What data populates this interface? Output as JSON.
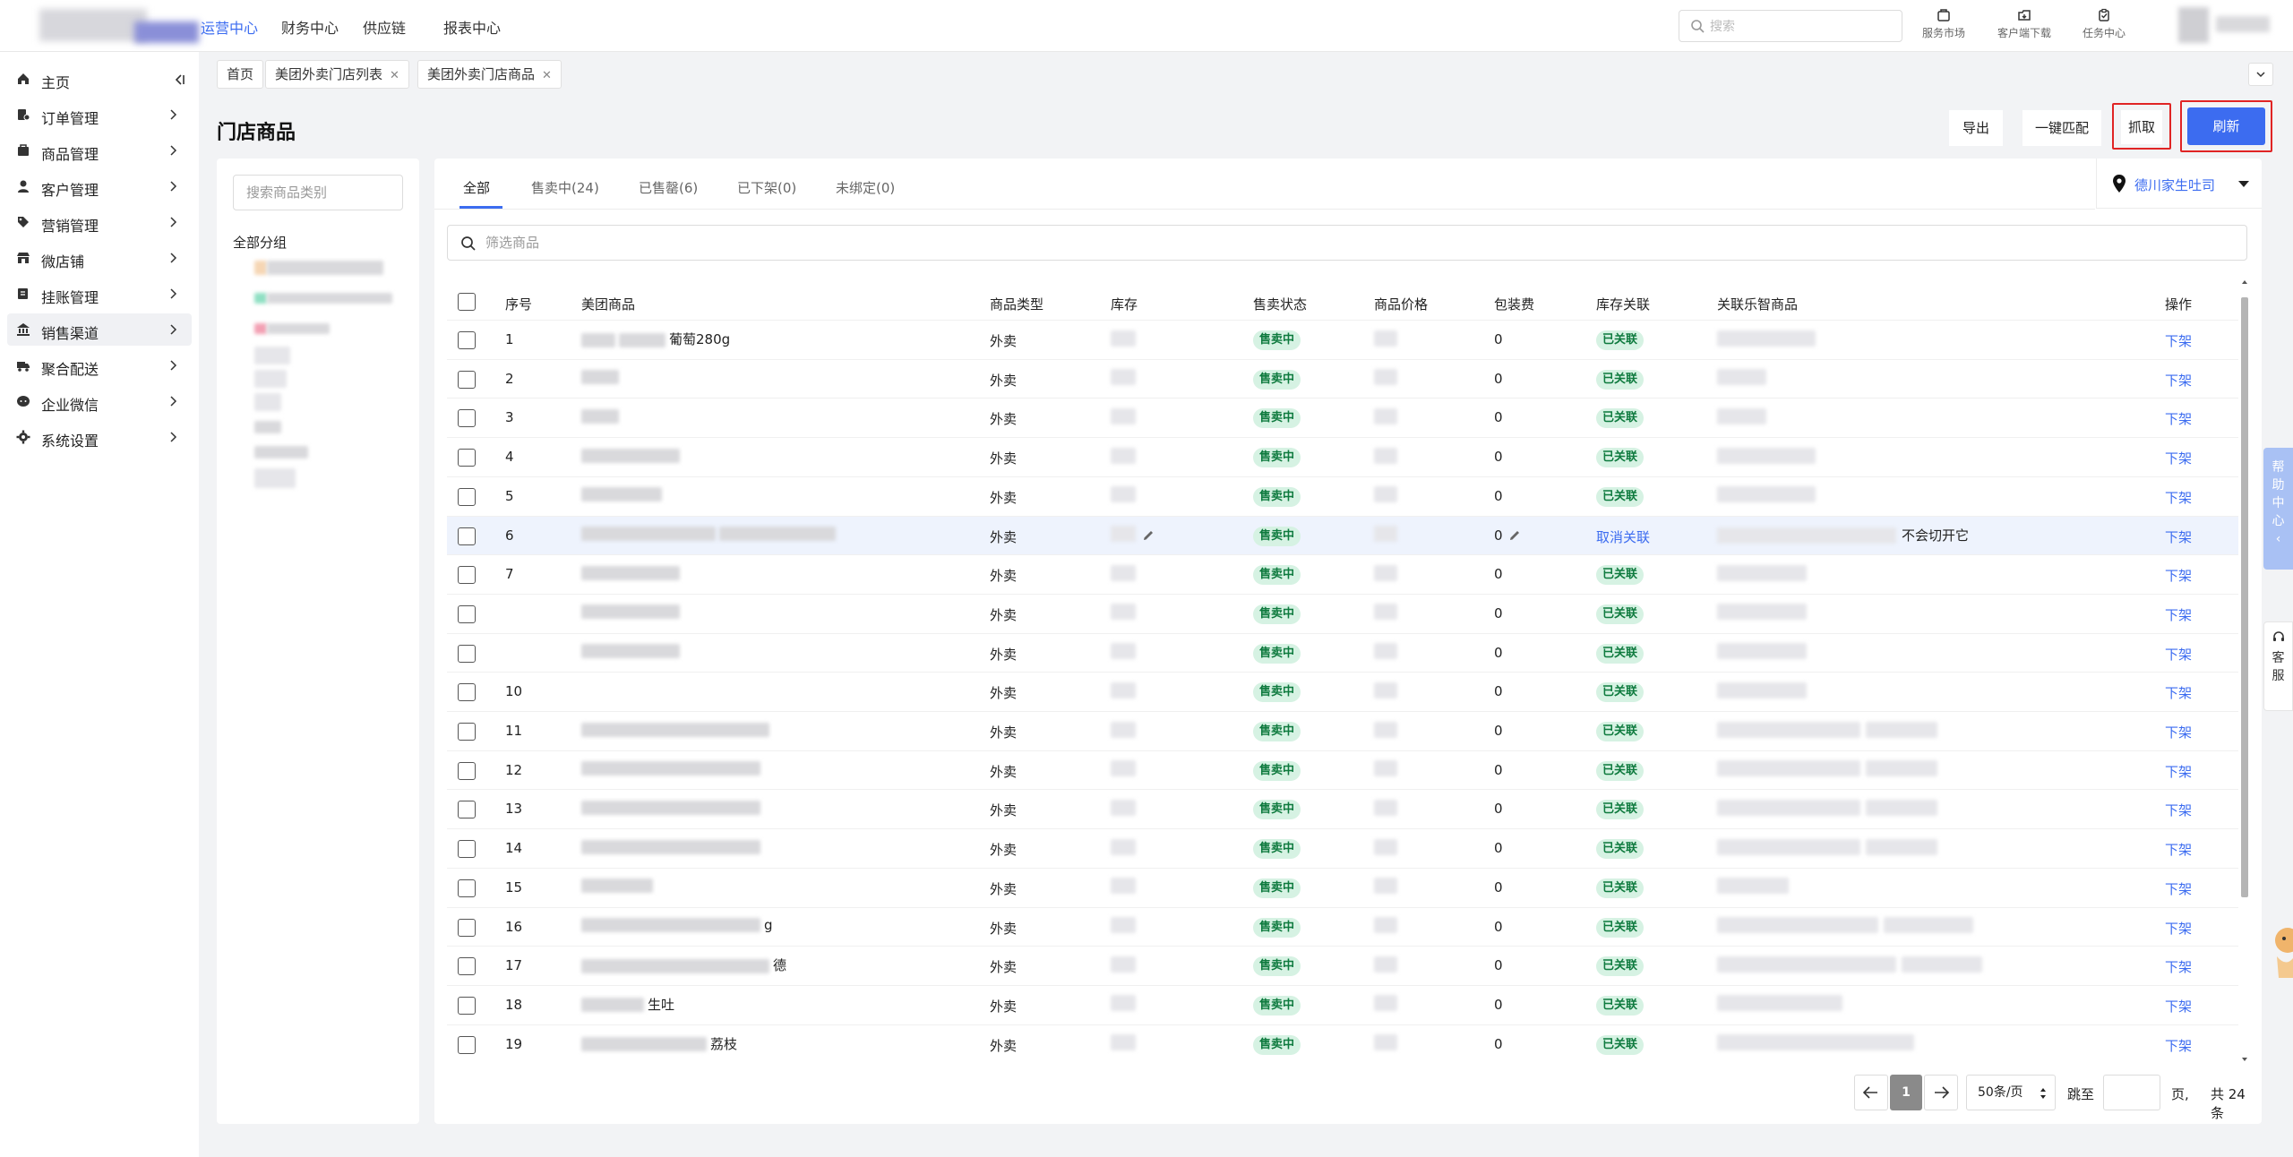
{
  "nav": {
    "menus": [
      "运营中心",
      "财务中心",
      "供应链",
      "报表中心"
    ],
    "search_placeholder": "搜索",
    "icons": [
      {
        "label": "服务市场",
        "icon": "shop-icon"
      },
      {
        "label": "客户端下载",
        "icon": "download-icon"
      },
      {
        "label": "任务中心",
        "icon": "task-icon"
      }
    ]
  },
  "sidebar": {
    "items": [
      {
        "label": "主页",
        "icon": "home-icon"
      },
      {
        "label": "订单管理",
        "icon": "order-icon"
      },
      {
        "label": "商品管理",
        "icon": "goods-icon"
      },
      {
        "label": "客户管理",
        "icon": "customer-icon"
      },
      {
        "label": "营销管理",
        "icon": "tag-icon"
      },
      {
        "label": "微店铺",
        "icon": "store-icon"
      },
      {
        "label": "挂账管理",
        "icon": "ledger-icon"
      },
      {
        "label": "销售渠道",
        "icon": "bank-icon",
        "active": true
      },
      {
        "label": "聚合配送",
        "icon": "truck-icon"
      },
      {
        "label": "企业微信",
        "icon": "wechat-icon"
      },
      {
        "label": "系统设置",
        "icon": "gear-icon"
      }
    ]
  },
  "pagetabs": [
    {
      "label": "首页",
      "closable": false
    },
    {
      "label": "美团外卖门店列表",
      "closable": true
    },
    {
      "label": "美团外卖门店商品",
      "closable": true
    }
  ],
  "header": {
    "title": "门店商品",
    "export": "导出",
    "match": "一键匹配",
    "fetch": "抓取",
    "refresh": "刷新"
  },
  "category": {
    "search_placeholder": "搜索商品类别",
    "all": "全部分组"
  },
  "filter_tabs": [
    {
      "label": "全部",
      "active": true
    },
    {
      "label": "售卖中(24)"
    },
    {
      "label": "已售罄(6)"
    },
    {
      "label": "已下架(0)"
    },
    {
      "label": "未绑定(0)"
    }
  ],
  "store": {
    "name": "德川家生吐司"
  },
  "filter_placeholder": "筛选商品",
  "table": {
    "columns": [
      "序号",
      "美团商品",
      "商品类型",
      "库存",
      "售卖状态",
      "商品价格",
      "包装费",
      "库存关联",
      "关联乐智商品",
      "操作"
    ],
    "rows": [
      {
        "seq": "1",
        "name": "葡萄280g",
        "type": "外卖",
        "status": "售卖中",
        "fee": "0",
        "link": "已关联",
        "op": "下架"
      },
      {
        "seq": "2",
        "name": "",
        "type": "外卖",
        "status": "售卖中",
        "fee": "0",
        "link": "已关联",
        "op": "下架"
      },
      {
        "seq": "3",
        "name": "",
        "type": "外卖",
        "status": "售卖中",
        "fee": "0",
        "link": "已关联",
        "op": "下架"
      },
      {
        "seq": "4",
        "name": "",
        "type": "外卖",
        "status": "售卖中",
        "fee": "0",
        "link": "已关联",
        "op": "下架"
      },
      {
        "seq": "5",
        "name": "",
        "type": "外卖",
        "status": "售卖中",
        "fee": "0",
        "link": "已关联",
        "op": "下架"
      },
      {
        "seq": "6",
        "name": "",
        "type": "外卖",
        "status": "售卖中",
        "fee": "0",
        "link": "取消关联",
        "linked_name": "不会切开它",
        "op": "下架",
        "highlight": true
      },
      {
        "seq": "7",
        "name": "",
        "type": "外卖",
        "status": "售卖中",
        "fee": "0",
        "link": "已关联",
        "op": "下架"
      },
      {
        "seq": "",
        "name": "",
        "type": "外卖",
        "status": "售卖中",
        "fee": "0",
        "link": "已关联",
        "op": "下架"
      },
      {
        "seq": "",
        "name": "",
        "type": "外卖",
        "status": "售卖中",
        "fee": "0",
        "link": "已关联",
        "op": "下架"
      },
      {
        "seq": "10",
        "name": "",
        "type": "外卖",
        "status": "售卖中",
        "fee": "0",
        "link": "已关联",
        "op": "下架"
      },
      {
        "seq": "11",
        "name": "",
        "type": "外卖",
        "status": "售卖中",
        "fee": "0",
        "link": "已关联",
        "op": "下架"
      },
      {
        "seq": "12",
        "name": "",
        "type": "外卖",
        "status": "售卖中",
        "fee": "0",
        "link": "已关联",
        "op": "下架"
      },
      {
        "seq": "13",
        "name": "",
        "type": "外卖",
        "status": "售卖中",
        "fee": "0",
        "link": "已关联",
        "op": "下架"
      },
      {
        "seq": "14",
        "name": "",
        "type": "外卖",
        "status": "售卖中",
        "fee": "0",
        "link": "已关联",
        "op": "下架"
      },
      {
        "seq": "15",
        "name": "",
        "type": "外卖",
        "status": "售卖中",
        "fee": "0",
        "link": "已关联",
        "op": "下架"
      },
      {
        "seq": "16",
        "name": "g",
        "type": "外卖",
        "status": "售卖中",
        "fee": "0",
        "link": "已关联",
        "op": "下架"
      },
      {
        "seq": "17",
        "name": "德",
        "type": "外卖",
        "status": "售卖中",
        "fee": "0",
        "link": "已关联",
        "op": "下架"
      },
      {
        "seq": "18",
        "name": "生吐",
        "type": "外卖",
        "status": "售卖中",
        "fee": "0",
        "link": "已关联",
        "op": "下架"
      },
      {
        "seq": "19",
        "name": "荔枝",
        "type": "外卖",
        "status": "售卖中",
        "fee": "0",
        "link": "已关联",
        "op": "下架"
      }
    ]
  },
  "pager": {
    "current": "1",
    "page_size": "50条/页",
    "jump_label": "跳至",
    "page_unit": "页,",
    "total": "共 24 条"
  },
  "floating": {
    "help": [
      "帮",
      "助",
      "中",
      "心"
    ],
    "kefu": [
      "客",
      "服"
    ]
  },
  "colors": {
    "accent": "#3c6cf0",
    "danger_outline": "#e02424",
    "badge_bg": "#d6f2e3",
    "badge_text": "#0e7a3e"
  }
}
